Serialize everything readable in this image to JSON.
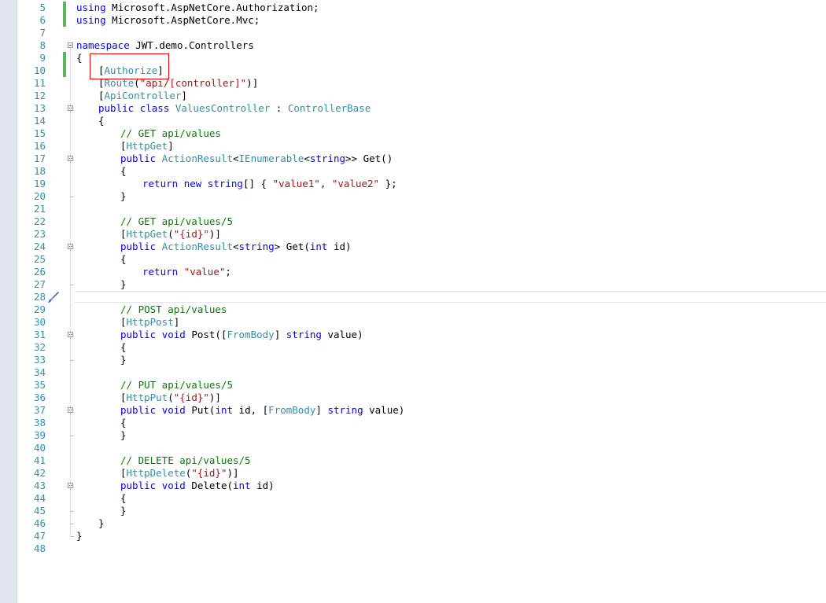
{
  "editor": {
    "lines": [
      {
        "num": "5",
        "indent": 0,
        "tokens": [
          [
            "using",
            "kw"
          ],
          [
            " Microsoft.AspNetCore.Authorization;",
            ""
          ]
        ]
      },
      {
        "num": "6",
        "indent": 0,
        "tokens": [
          [
            "using",
            "kw"
          ],
          [
            " Microsoft.AspNetCore.Mvc;",
            ""
          ]
        ]
      },
      {
        "num": "7",
        "indent": 0,
        "tokens": []
      },
      {
        "num": "8",
        "indent": 0,
        "tokens": [
          [
            "namespace",
            "kw"
          ],
          [
            " JWT.demo.Controllers",
            ""
          ]
        ]
      },
      {
        "num": "9",
        "indent": 0,
        "tokens": [
          [
            "{",
            ""
          ]
        ]
      },
      {
        "num": "10",
        "indent": 1,
        "tokens": [
          [
            "[",
            ""
          ],
          [
            "Authorize",
            "ty"
          ],
          [
            "]",
            ""
          ]
        ]
      },
      {
        "num": "11",
        "indent": 1,
        "tokens": [
          [
            "[",
            ""
          ],
          [
            "Route",
            "ty"
          ],
          [
            "(",
            ""
          ],
          [
            "\"api/[controller]\"",
            "st"
          ],
          [
            ")]",
            ""
          ]
        ]
      },
      {
        "num": "12",
        "indent": 1,
        "tokens": [
          [
            "[",
            ""
          ],
          [
            "ApiController",
            "ty"
          ],
          [
            "]",
            ""
          ]
        ]
      },
      {
        "num": "13",
        "indent": 1,
        "tokens": [
          [
            "public",
            "kw"
          ],
          [
            " ",
            ""
          ],
          [
            "class",
            "kw"
          ],
          [
            " ",
            ""
          ],
          [
            "ValuesController",
            "ty"
          ],
          [
            " : ",
            ""
          ],
          [
            "ControllerBase",
            "ty"
          ]
        ]
      },
      {
        "num": "14",
        "indent": 1,
        "tokens": [
          [
            "{",
            ""
          ]
        ]
      },
      {
        "num": "15",
        "indent": 2,
        "tokens": [
          [
            "// GET api/values",
            "cm"
          ]
        ]
      },
      {
        "num": "16",
        "indent": 2,
        "tokens": [
          [
            "[",
            ""
          ],
          [
            "HttpGet",
            "ty"
          ],
          [
            "]",
            ""
          ]
        ]
      },
      {
        "num": "17",
        "indent": 2,
        "tokens": [
          [
            "public",
            "kw"
          ],
          [
            " ",
            ""
          ],
          [
            "ActionResult",
            "ty"
          ],
          [
            "<",
            ""
          ],
          [
            "IEnumerable",
            "ty"
          ],
          [
            "<",
            ""
          ],
          [
            "string",
            "kw"
          ],
          [
            ">> Get()",
            ""
          ]
        ]
      },
      {
        "num": "18",
        "indent": 2,
        "tokens": [
          [
            "{",
            ""
          ]
        ]
      },
      {
        "num": "19",
        "indent": 3,
        "tokens": [
          [
            "return",
            "kw"
          ],
          [
            " ",
            ""
          ],
          [
            "new",
            "kw"
          ],
          [
            " ",
            ""
          ],
          [
            "string",
            "kw"
          ],
          [
            "[] { ",
            ""
          ],
          [
            "\"value1\"",
            "st"
          ],
          [
            ", ",
            ""
          ],
          [
            "\"value2\"",
            "st"
          ],
          [
            " };",
            ""
          ]
        ]
      },
      {
        "num": "20",
        "indent": 2,
        "tokens": [
          [
            "}",
            ""
          ]
        ]
      },
      {
        "num": "21",
        "indent": 0,
        "tokens": []
      },
      {
        "num": "22",
        "indent": 2,
        "tokens": [
          [
            "// GET api/values/5",
            "cm"
          ]
        ]
      },
      {
        "num": "23",
        "indent": 2,
        "tokens": [
          [
            "[",
            ""
          ],
          [
            "HttpGet",
            "ty"
          ],
          [
            "(",
            ""
          ],
          [
            "\"{id}\"",
            "st"
          ],
          [
            ")]",
            ""
          ]
        ]
      },
      {
        "num": "24",
        "indent": 2,
        "tokens": [
          [
            "public",
            "kw"
          ],
          [
            " ",
            ""
          ],
          [
            "ActionResult",
            "ty"
          ],
          [
            "<",
            ""
          ],
          [
            "string",
            "kw"
          ],
          [
            "> Get(",
            ""
          ],
          [
            "int",
            "kw"
          ],
          [
            " id)",
            ""
          ]
        ]
      },
      {
        "num": "25",
        "indent": 2,
        "tokens": [
          [
            "{",
            ""
          ]
        ]
      },
      {
        "num": "26",
        "indent": 3,
        "tokens": [
          [
            "return",
            "kw"
          ],
          [
            " ",
            ""
          ],
          [
            "\"value\"",
            "st"
          ],
          [
            ";",
            ""
          ]
        ]
      },
      {
        "num": "27",
        "indent": 2,
        "tokens": [
          [
            "}",
            ""
          ]
        ]
      },
      {
        "num": "28",
        "indent": 0,
        "tokens": []
      },
      {
        "num": "29",
        "indent": 2,
        "tokens": [
          [
            "// POST api/values",
            "cm"
          ]
        ]
      },
      {
        "num": "30",
        "indent": 2,
        "tokens": [
          [
            "[",
            ""
          ],
          [
            "HttpPost",
            "ty"
          ],
          [
            "]",
            ""
          ]
        ]
      },
      {
        "num": "31",
        "indent": 2,
        "tokens": [
          [
            "public",
            "kw"
          ],
          [
            " ",
            ""
          ],
          [
            "void",
            "kw"
          ],
          [
            " Post([",
            ""
          ],
          [
            "FromBody",
            "ty"
          ],
          [
            "] ",
            ""
          ],
          [
            "string",
            "kw"
          ],
          [
            " value)",
            ""
          ]
        ]
      },
      {
        "num": "32",
        "indent": 2,
        "tokens": [
          [
            "{",
            ""
          ]
        ]
      },
      {
        "num": "33",
        "indent": 2,
        "tokens": [
          [
            "}",
            ""
          ]
        ]
      },
      {
        "num": "34",
        "indent": 0,
        "tokens": []
      },
      {
        "num": "35",
        "indent": 2,
        "tokens": [
          [
            "// PUT api/values/5",
            "cm"
          ]
        ]
      },
      {
        "num": "36",
        "indent": 2,
        "tokens": [
          [
            "[",
            ""
          ],
          [
            "HttpPut",
            "ty"
          ],
          [
            "(",
            ""
          ],
          [
            "\"{id}\"",
            "st"
          ],
          [
            ")]",
            ""
          ]
        ]
      },
      {
        "num": "37",
        "indent": 2,
        "tokens": [
          [
            "public",
            "kw"
          ],
          [
            " ",
            ""
          ],
          [
            "void",
            "kw"
          ],
          [
            " Put(",
            ""
          ],
          [
            "int",
            "kw"
          ],
          [
            " id, [",
            ""
          ],
          [
            "FromBody",
            "ty"
          ],
          [
            "] ",
            ""
          ],
          [
            "string",
            "kw"
          ],
          [
            " value)",
            ""
          ]
        ]
      },
      {
        "num": "38",
        "indent": 2,
        "tokens": [
          [
            "{",
            ""
          ]
        ]
      },
      {
        "num": "39",
        "indent": 2,
        "tokens": [
          [
            "}",
            ""
          ]
        ]
      },
      {
        "num": "40",
        "indent": 0,
        "tokens": []
      },
      {
        "num": "41",
        "indent": 2,
        "tokens": [
          [
            "// DELETE api/values/5",
            "cm"
          ]
        ]
      },
      {
        "num": "42",
        "indent": 2,
        "tokens": [
          [
            "[",
            ""
          ],
          [
            "HttpDelete",
            "ty"
          ],
          [
            "(",
            ""
          ],
          [
            "\"{id}\"",
            "st"
          ],
          [
            ")]",
            ""
          ]
        ]
      },
      {
        "num": "43",
        "indent": 2,
        "tokens": [
          [
            "public",
            "kw"
          ],
          [
            " ",
            ""
          ],
          [
            "void",
            "kw"
          ],
          [
            " Delete(",
            ""
          ],
          [
            "int",
            "kw"
          ],
          [
            " id)",
            ""
          ]
        ]
      },
      {
        "num": "44",
        "indent": 2,
        "tokens": [
          [
            "{",
            ""
          ]
        ]
      },
      {
        "num": "45",
        "indent": 2,
        "tokens": [
          [
            "}",
            ""
          ]
        ]
      },
      {
        "num": "46",
        "indent": 1,
        "tokens": [
          [
            "}",
            ""
          ]
        ]
      },
      {
        "num": "47",
        "indent": 0,
        "tokens": [
          [
            "}",
            ""
          ]
        ]
      },
      {
        "num": "48",
        "indent": 0,
        "tokens": []
      }
    ],
    "changed_lines": [
      "5",
      "6",
      "9",
      "10"
    ],
    "fold_lines": [
      "8",
      "13",
      "17",
      "24",
      "31",
      "37",
      "43"
    ],
    "active_line": "28",
    "highlight_target": "Authorize",
    "quick_action_icon": "paintbrush-icon",
    "colors": {
      "keyword": "#0000ff",
      "type": "#2b91af",
      "string": "#a31515",
      "comment": "#008000",
      "line_number": "#2b91af",
      "change_bar": "#5fb35f",
      "highlight_box": "#ff0000"
    }
  }
}
